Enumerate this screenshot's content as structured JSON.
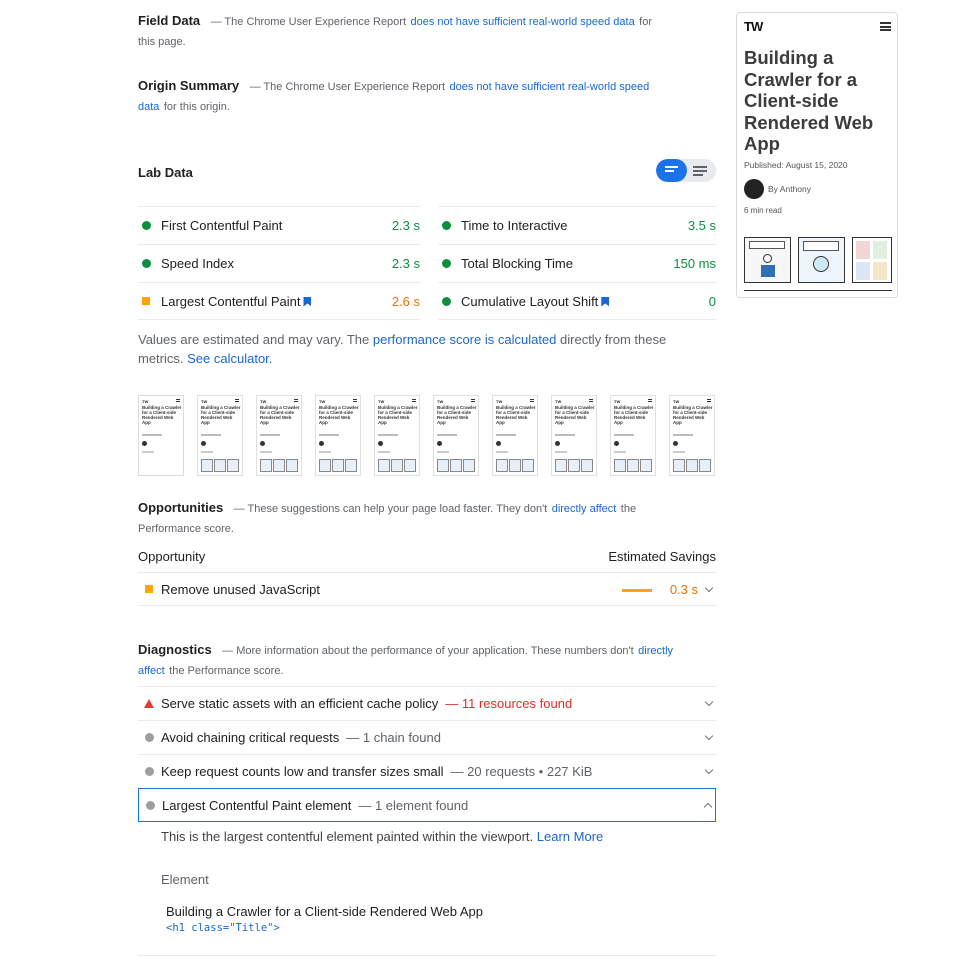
{
  "field_data": {
    "title": "Field Data",
    "desc_before": "— The Chrome User Experience Report",
    "link": "does not have sufficient real-world speed data",
    "desc_after": "for",
    "desc_line2": "this page."
  },
  "origin_summary": {
    "title": "Origin Summary",
    "desc_before": "— The Chrome User Experience Report",
    "link_part1": "does not have sufficient real-world speed",
    "link_part2": "data",
    "desc_after": "for this origin."
  },
  "lab_data": {
    "title": "Lab Data",
    "metrics": [
      {
        "name": "First Contentful Paint",
        "value": "2.3 s",
        "status": "green"
      },
      {
        "name": "Time to Interactive",
        "value": "3.5 s",
        "status": "green"
      },
      {
        "name": "Speed Index",
        "value": "2.3 s",
        "status": "green"
      },
      {
        "name": "Total Blocking Time",
        "value": "150 ms",
        "status": "green"
      },
      {
        "name": "Largest Contentful Paint",
        "value": "2.6 s",
        "status": "orange"
      },
      {
        "name": "Cumulative Layout Shift",
        "value": "0",
        "status": "green"
      }
    ],
    "note_before": "Values are estimated and may vary. The",
    "note_link": "performance score is calculated",
    "note_after": "directly from these",
    "note_line2": "metrics.",
    "calculator_link": "See calculator."
  },
  "filmstrip": {
    "frame_logo": "TW",
    "frame_title": "Building a Crawler for a Client-side Rendered Web App",
    "count": 10
  },
  "opportunities": {
    "title": "Opportunities",
    "desc_before": "— These suggestions can help your page load faster. They don't",
    "link": "directly affect",
    "desc_after": "the",
    "desc_line2": "Performance score.",
    "col_left": "Opportunity",
    "col_right": "Estimated Savings",
    "items": [
      {
        "title": "Remove unused JavaScript",
        "savings": "0.3 s"
      }
    ]
  },
  "diagnostics": {
    "title": "Diagnostics",
    "desc_before": "— More information about the performance of your application. These numbers don't",
    "link_part1": "directly",
    "link_part2": "affect",
    "desc_after": "the Performance score.",
    "items": [
      {
        "title": "Serve static assets with an efficient cache policy",
        "detail": "— 11 resources found",
        "severity": "fail"
      },
      {
        "title": "Avoid chaining critical requests",
        "detail": "— 1 chain found",
        "severity": "info"
      },
      {
        "title": "Keep request counts low and transfer sizes small",
        "detail": "— 20 requests • 227 KiB",
        "severity": "info"
      },
      {
        "title": "Largest Contentful Paint element",
        "detail": "— 1 element found",
        "severity": "info"
      }
    ],
    "expanded": {
      "desc": "This is the largest contentful element painted within the viewport.",
      "learn_more": "Learn More",
      "column": "Element",
      "element_text": "Building a Crawler for a Client-side Rendered Web App",
      "element_snippet": "<h1 class=\"Title\">"
    }
  },
  "preview": {
    "logo": "TW",
    "title": "Building a Crawler for a Client-side Rendered Web App",
    "published": "Published: August 15, 2020",
    "author": "By Anthony",
    "read_time": "6 min read"
  },
  "colors": {
    "link": "#1967d2",
    "pass": "#0c8f3c",
    "average": "#e8710a",
    "fail": "#d93025",
    "toggle_active": "#1a73e8"
  }
}
